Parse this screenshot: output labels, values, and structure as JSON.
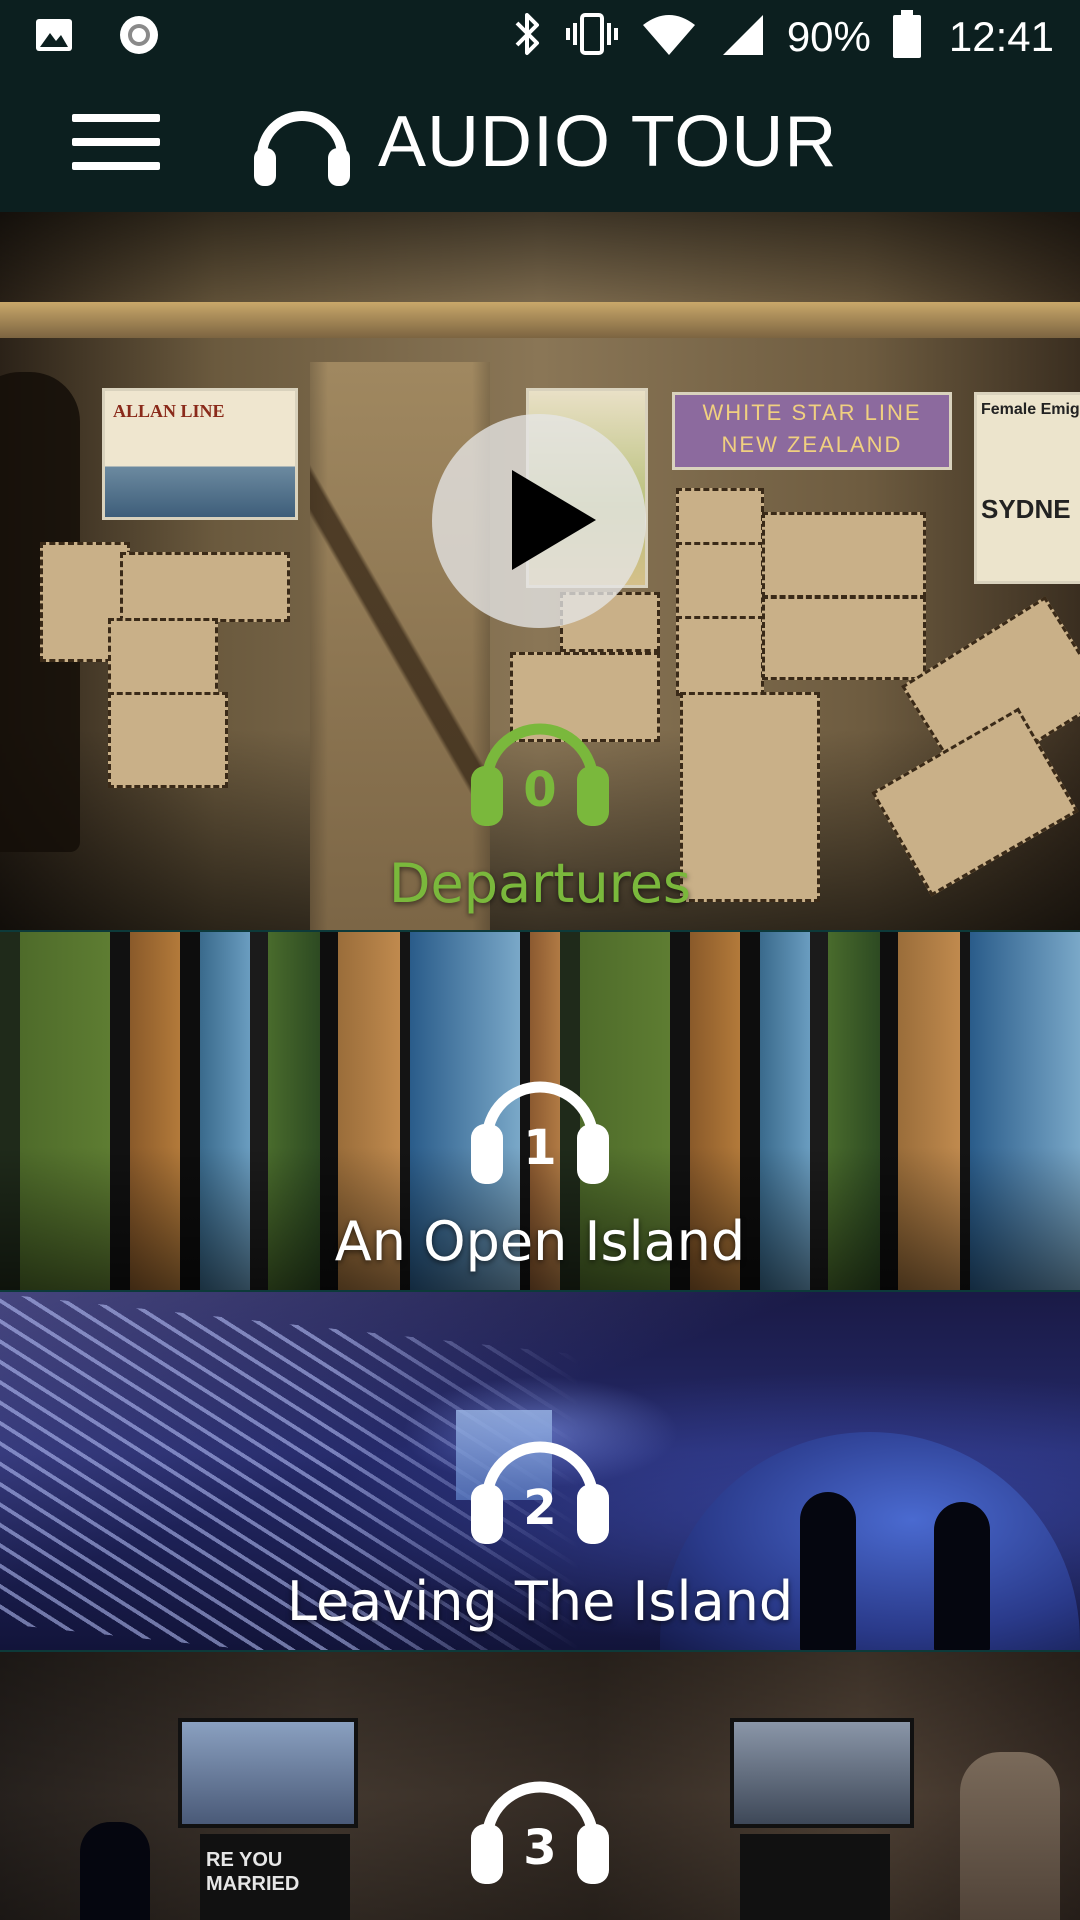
{
  "status_bar": {
    "battery_percent": "90%",
    "time": "12:41",
    "icons": [
      "image-icon",
      "record-icon",
      "bluetooth-icon",
      "vibrate-icon",
      "wifi-icon",
      "cell-signal-icon",
      "battery-icon"
    ]
  },
  "app_bar": {
    "title": "AUDIO TOUR",
    "menu_icon": "hamburger-menu-icon",
    "brand_icon": "headphones-icon"
  },
  "colors": {
    "bar_bg": "#0c1f1f",
    "active": "#7ab83c",
    "inactive": "#ffffff"
  },
  "tour": {
    "stops": [
      {
        "number": "0",
        "title": "Departures",
        "active": true,
        "scene": "storage room with crates and posters"
      },
      {
        "number": "1",
        "title": "An Open Island",
        "active": false,
        "scene": "landscape panels"
      },
      {
        "number": "2",
        "title": "Leaving The Island",
        "active": false,
        "scene": "blue lit exhibition room"
      },
      {
        "number": "3",
        "title": "",
        "active": false,
        "scene": "screens room"
      }
    ],
    "play_icon": "play-icon"
  },
  "scene_text": {
    "poster_1": "ALLAN LINE",
    "poster_3_line1": "WHITE STAR LINE",
    "poster_3_line2": "NEW ZEALAND",
    "poster_4_line1": "Female Emigr",
    "poster_4_line2": "SYDNE",
    "sign_1": "RE YOU MARRIED"
  }
}
